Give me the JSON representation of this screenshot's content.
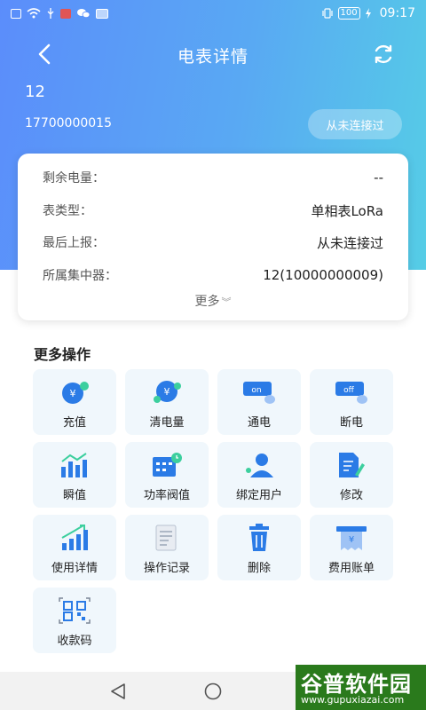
{
  "status_bar": {
    "battery": "100",
    "time": "09:17"
  },
  "header": {
    "title": "电表详情"
  },
  "device": {
    "name": "12",
    "id": "17700000015",
    "connection_status": "从未连接过"
  },
  "info": {
    "rows": [
      {
        "label": "剩余电量：",
        "value": "--"
      },
      {
        "label": "表类型：",
        "value": "单相表LoRa"
      },
      {
        "label": "最后上报：",
        "value": "从未连接过"
      },
      {
        "label": "所属集中器：",
        "value": "12(10000000009)"
      }
    ],
    "more_label": "更多"
  },
  "operations": {
    "title": "更多操作",
    "items": [
      {
        "label": "充值",
        "icon": "recharge-icon"
      },
      {
        "label": "清电量",
        "icon": "clear-power-icon"
      },
      {
        "label": "通电",
        "icon": "power-on-icon"
      },
      {
        "label": "断电",
        "icon": "power-off-icon"
      },
      {
        "label": "瞬值",
        "icon": "instant-value-icon"
      },
      {
        "label": "功率阀值",
        "icon": "power-threshold-icon"
      },
      {
        "label": "绑定用户",
        "icon": "bind-user-icon"
      },
      {
        "label": "修改",
        "icon": "edit-icon"
      },
      {
        "label": "使用详情",
        "icon": "usage-detail-icon"
      },
      {
        "label": "操作记录",
        "icon": "operation-log-icon"
      },
      {
        "label": "删除",
        "icon": "delete-icon"
      },
      {
        "label": "费用账单",
        "icon": "bill-icon"
      },
      {
        "label": "收款码",
        "icon": "qr-code-icon"
      }
    ],
    "on_text": "on",
    "off_text": "off",
    "yen": "¥"
  },
  "watermark": {
    "main": "谷普软件园",
    "url": "www.gupuxiazai.com"
  },
  "colors": {
    "accent": "#3f8cf0",
    "header_start": "#5b8dfb",
    "header_end": "#55cde6",
    "tile_bg": "#f0f7fc"
  }
}
